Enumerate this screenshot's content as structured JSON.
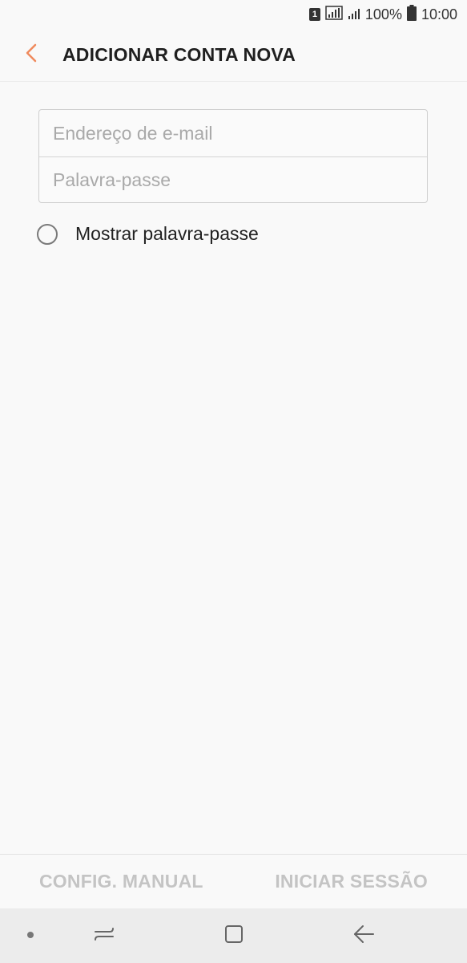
{
  "status_bar": {
    "sim_label": "1",
    "battery": "100%",
    "time": "10:00"
  },
  "header": {
    "title": "ADICIONAR CONTA NOVA",
    "back_icon": "chevron-left-icon",
    "accent": "#f08a5d"
  },
  "form": {
    "email_placeholder": "Endereço de e-mail",
    "email_value": "",
    "password_placeholder": "Palavra-passe",
    "password_value": "",
    "show_password_label": "Mostrar palavra-passe",
    "show_password_checked": false
  },
  "actions": {
    "manual_label": "CONFIG. MANUAL",
    "signin_label": "INICIAR SESSÃO",
    "disabled_color": "#c4c4c4"
  },
  "nav": {
    "items": [
      "dot-icon",
      "recents-icon",
      "home-icon",
      "back-icon"
    ]
  }
}
